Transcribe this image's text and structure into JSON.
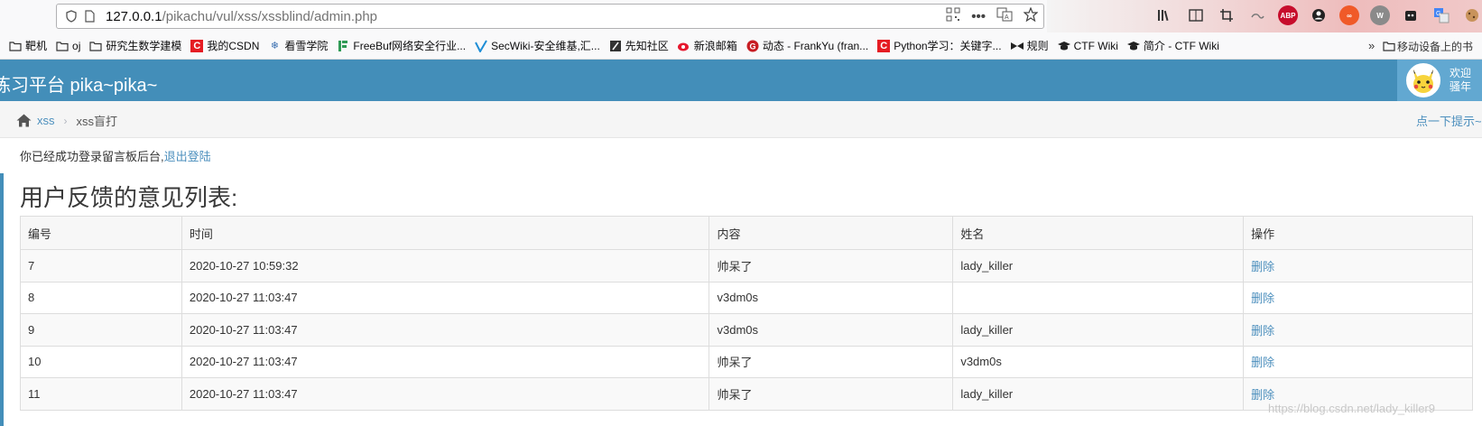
{
  "browser": {
    "url_host": "127.0.0.1",
    "url_path": "/pikachu/vul/xss/xssblind/admin.php",
    "bookmarks": [
      {
        "label": "靶机",
        "icon": "folder-icon"
      },
      {
        "label": "oj",
        "icon": "folder-icon"
      },
      {
        "label": "研究生数学建模",
        "icon": "folder-icon"
      },
      {
        "label": "我的CSDN",
        "icon": "csdn-icon",
        "color": "#e51c23"
      },
      {
        "label": "看雪学院",
        "icon": "snowflake-icon",
        "color": "#3a6fb0"
      },
      {
        "label": "FreeBuf网络安全行业...",
        "icon": "freebuf-icon",
        "color": "#2f9a55"
      },
      {
        "label": "SecWiki-安全维基,汇...",
        "icon": "secwiki-icon",
        "color": "#1f8ed6"
      },
      {
        "label": "先知社区",
        "icon": "xianzhi-icon",
        "color": "#333333"
      },
      {
        "label": "新浪邮箱",
        "icon": "sina-icon",
        "color": "#e6162d"
      },
      {
        "label": "动态 - FrankYu (fran...",
        "icon": "gitee-icon",
        "color": "#c71d23"
      },
      {
        "label": "Python学习：关键字...",
        "icon": "csdn-icon",
        "color": "#e51c23"
      },
      {
        "label": "规则",
        "icon": "bow-icon",
        "color": "#222222"
      },
      {
        "label": "CTF Wiki",
        "icon": "graduation-cap-icon",
        "color": "#222222"
      },
      {
        "label": "简介 - CTF Wiki",
        "icon": "graduation-cap-icon",
        "color": "#222222"
      }
    ],
    "more_label": "»",
    "mobile_label": "移动设备上的书"
  },
  "site": {
    "brand": "练习平台 pika~pika~",
    "welcome_line1": "欢迎",
    "welcome_line2": "骚年"
  },
  "breadcrumb": {
    "home_label": "xss",
    "current_label": "xss盲打",
    "hint_label": "点一下提示~"
  },
  "main": {
    "login_text": "你已经成功登录留言板后台,",
    "logout_label": "退出登陆",
    "list_title": "用户反馈的意见列表:",
    "columns": [
      "编号",
      "时间",
      "内容",
      "姓名",
      "操作"
    ],
    "rows": [
      {
        "id": "7",
        "time": "2020-10-27 10:59:32",
        "content": "帅呆了",
        "name": "lady_killer",
        "op": "删除"
      },
      {
        "id": "8",
        "time": "2020-10-27 11:03:47",
        "content": "v3dm0s",
        "name": "",
        "op": "删除"
      },
      {
        "id": "9",
        "time": "2020-10-27 11:03:47",
        "content": "v3dm0s",
        "name": "lady_killer",
        "op": "删除"
      },
      {
        "id": "10",
        "time": "2020-10-27 11:03:47",
        "content": "帅呆了",
        "name": "v3dm0s",
        "op": "删除"
      },
      {
        "id": "11",
        "time": "2020-10-27 11:03:47",
        "content": "帅呆了",
        "name": "lady_killer",
        "op": "删除"
      }
    ]
  },
  "watermark": "https://blog.csdn.net/lady_killer9",
  "colors": {
    "navbar": "#438eb9",
    "link": "#4c8fbd",
    "user_area": "#62a8d1"
  }
}
